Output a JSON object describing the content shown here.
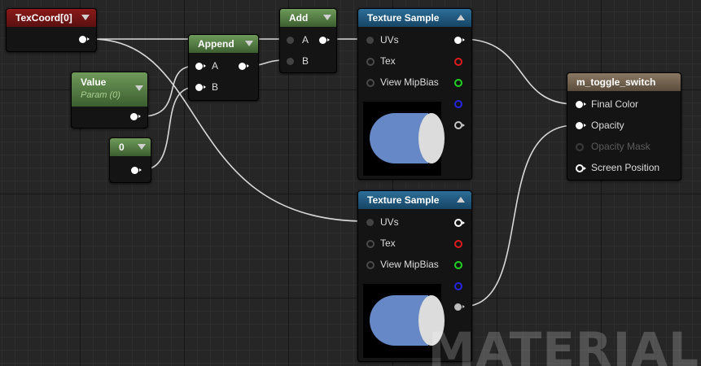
{
  "nodes": {
    "texcoord": {
      "title": "TexCoord[0]"
    },
    "value": {
      "title": "Value",
      "subtitle": "Param (0)"
    },
    "zero": {
      "title": "0"
    },
    "append": {
      "title": "Append",
      "inputs": [
        "A",
        "B"
      ]
    },
    "add": {
      "title": "Add",
      "inputs": [
        "A",
        "B"
      ]
    },
    "texture_sample_1": {
      "title": "Texture Sample",
      "pins": [
        "UVs",
        "Tex",
        "View MipBias"
      ]
    },
    "texture_sample_2": {
      "title": "Texture Sample",
      "pins": [
        "UVs",
        "Tex",
        "View MipBias"
      ]
    },
    "material": {
      "title": "m_toggle_switch",
      "pins": [
        "Final Color",
        "Opacity",
        "Opacity Mask",
        "Screen Position"
      ]
    }
  },
  "watermark": "MATERIAL",
  "colors": {
    "header_constant": "#7a1818",
    "header_math": "#5b8249",
    "header_texture": "#1f5a80",
    "header_result": "#6e604e",
    "pin_red": "#dd1c1c",
    "pin_green": "#21d321",
    "pin_blue": "#2525e0",
    "preview_cylinder": "#6688c6"
  }
}
